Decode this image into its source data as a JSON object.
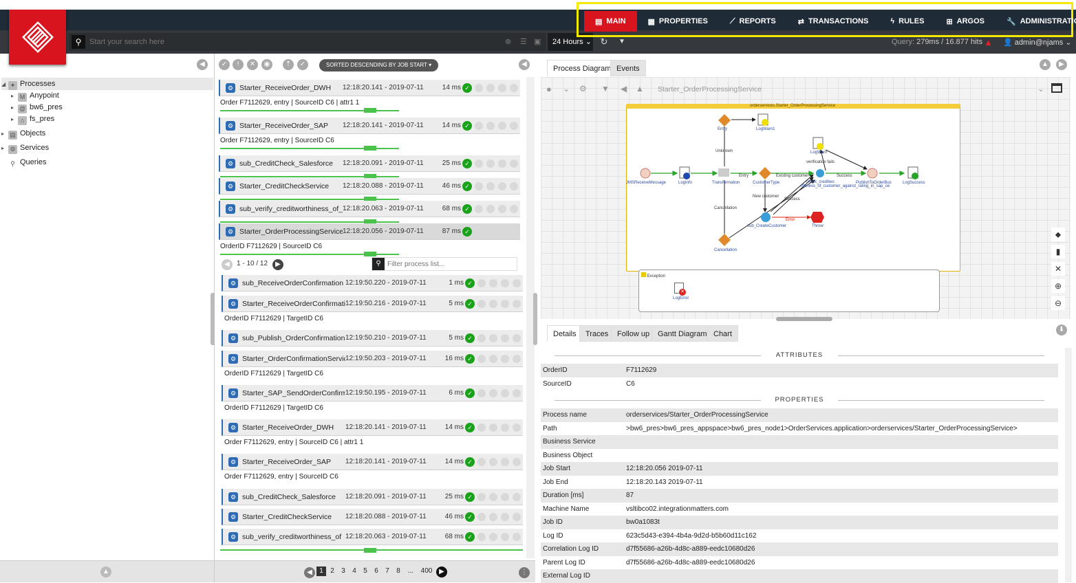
{
  "nav": {
    "items": [
      {
        "label": "MAIN",
        "icon": "main-icon",
        "active": true
      },
      {
        "label": "PROPERTIES",
        "icon": "properties-icon",
        "active": false
      },
      {
        "label": "REPORTS",
        "icon": "reports-icon",
        "active": false
      },
      {
        "label": "TRANSACTIONS",
        "icon": "transactions-icon",
        "active": false
      },
      {
        "label": "RULES",
        "icon": "rules-icon",
        "active": false
      },
      {
        "label": "ARGOS",
        "icon": "argos-icon",
        "active": false
      },
      {
        "label": "ADMINISTRATION",
        "icon": "administration-icon",
        "active": false
      }
    ]
  },
  "search": {
    "placeholder": "Start your search here"
  },
  "timerange": {
    "label": "24 Hours"
  },
  "query": {
    "prefix": "Query:",
    "value": "279ms / 16.877 hits"
  },
  "user": {
    "name": "admin@njams"
  },
  "tree": {
    "processes": "Processes",
    "anypoint": "Anypoint",
    "bw6": "bw6_pres",
    "fs": "fs_pres",
    "objects": "Objects",
    "services": "Services",
    "queries": "Queries"
  },
  "sort": {
    "label": "SORTED DESCENDING BY JOB START"
  },
  "rows": [
    {
      "name": "Starter_ReceiveOrder_DWH",
      "time": "12:18:20.141 - 2019-07-11",
      "dur": "14 ms",
      "attrs": "Order F7112629, entry | SourceID C6 | attr1 1"
    },
    {
      "name": "Starter_ReceiveOrder_SAP",
      "time": "12:18:20.141 - 2019-07-11",
      "dur": "14 ms",
      "attrs": "Order F7112629, entry | SourceID C6"
    },
    {
      "name": "sub_CreditCheck_Salesforce",
      "time": "12:18:20.091 - 2019-07-11",
      "dur": "25 ms"
    },
    {
      "name": "Starter_CreditCheckService",
      "time": "12:18:20.088 - 2019-07-11",
      "dur": "46 ms"
    },
    {
      "name": "sub_verify_creditworthiness_of_",
      "time": "12:18:20.063 - 2019-07-11",
      "dur": "68 ms"
    },
    {
      "name": "Starter_OrderProcessingService",
      "time": "12:18:20.056 - 2019-07-11",
      "dur": "87 ms",
      "attrs": "OrderID F7112629 | SourceID C6"
    }
  ],
  "subpager": {
    "range": "1 - 10 / 12",
    "filter_placeholder": "Filter process list..."
  },
  "subrows": [
    {
      "name": "sub_ReceiveOrderConfirmation",
      "time": "12:19:50.220 - 2019-07-11",
      "dur": "1 ms"
    },
    {
      "name": "Starter_ReceiveOrderConfirmation",
      "time": "12:19:50.216 - 2019-07-11",
      "dur": "5 ms",
      "attrs": "OrderID F7112629 | TargetID C6"
    },
    {
      "name": "sub_Publish_OrderConfirmation",
      "time": "12:19:50.210 - 2019-07-11",
      "dur": "5 ms"
    },
    {
      "name": "Starter_OrderConfirmationService",
      "time": "12:19:50.203 - 2019-07-11",
      "dur": "16 ms",
      "attrs": "OrderID F7112629 | TargetID C6"
    },
    {
      "name": "Starter_SAP_SendOrderConfirm",
      "time": "12:19:50.195 - 2019-07-11",
      "dur": "6 ms",
      "attrs": "OrderID F7112629 | TargetID C6"
    },
    {
      "name": "Starter_ReceiveOrder_DWH",
      "time": "12:18:20.141 - 2019-07-11",
      "dur": "14 ms",
      "attrs": "Order F7112629, entry | SourceID C6 | attr1 1"
    },
    {
      "name": "Starter_ReceiveOrder_SAP",
      "time": "12:18:20.141 - 2019-07-11",
      "dur": "14 ms",
      "attrs": "Order F7112629, entry | SourceID C6"
    },
    {
      "name": "sub_CreditCheck_Salesforce",
      "time": "12:18:20.091 - 2019-07-11",
      "dur": "25 ms"
    },
    {
      "name": "Starter_CreditCheckService",
      "time": "12:18:20.088 - 2019-07-11",
      "dur": "46 ms"
    },
    {
      "name": "sub_verify_creditworthiness_of",
      "time": "12:18:20.063 - 2019-07-11x",
      "dur": "68 ms"
    }
  ],
  "pager": {
    "pages": [
      "1",
      "2",
      "3",
      "4",
      "5",
      "6",
      "7",
      "8",
      "...",
      "400"
    ]
  },
  "diagram": {
    "tabs": [
      "Process Diagram",
      "Events"
    ],
    "process": "Starter_OrderProcessingService",
    "title": "orderservices.Starter_OrderProcessingService",
    "nodes": {
      "entry": "Entry",
      "logwarn1": "LogWarn1",
      "logwarn": "LogWarn",
      "jms": "JMSReceiveMessage",
      "loginfo": "LogInfo",
      "transformation": "Transformation",
      "customertype": "CustomerType",
      "check": "check_creditwo rthiness_of_customer_against_rating_in_sap_ce",
      "publish": "PublishToOrderBus",
      "logsuccess": "LogSuccess",
      "subcreate": "sub_CreateCustomer",
      "throw": "Throw",
      "cancellation": "Cancellation",
      "exception": "Exception",
      "logerror": "LogError"
    },
    "labels": {
      "unknown": "Unknown",
      "entry2": "Entry",
      "existing": "Existing customer",
      "verif": "verification fails",
      "success1": "Success",
      "newcust": "New customer",
      "success2": "Success",
      "error": "Error",
      "cancel": "Cancellation"
    }
  },
  "details": {
    "tabs": [
      "Details",
      "Traces",
      "Follow up",
      "Gantt Diagram",
      "Chart"
    ],
    "attributes_header": "ATTRIBUTES",
    "properties_header": "PROPERTIES",
    "attributes": [
      {
        "k": "OrderID",
        "v": "F7112629"
      },
      {
        "k": "SourceID",
        "v": "C6"
      }
    ],
    "properties": [
      {
        "k": "Process name",
        "v": "orderservices/Starter_OrderProcessingService"
      },
      {
        "k": "Path",
        "v": ">bw6_pres>bw6_pres_appspace>bw6_pres_node1>OrderServices.application>orderservices/Starter_OrderProcessingService>"
      },
      {
        "k": "Business Service",
        "v": ""
      },
      {
        "k": "Business Object",
        "v": ""
      },
      {
        "k": "Job Start",
        "v": "12:18:20.056   2019-07-11"
      },
      {
        "k": "Job End",
        "v": "12:18:20.143   2019-07-11"
      },
      {
        "k": "Duration [ms]",
        "v": "87"
      },
      {
        "k": "Machine Name",
        "v": "vsltibco02.integrationmatters.com"
      },
      {
        "k": "Job ID",
        "v": "bw0a1083t"
      },
      {
        "k": "Log ID",
        "v": "623c5d43-e394-4b4a-9d2d-b5b60d11c162"
      },
      {
        "k": "Correlation Log ID",
        "v": "d7f55686-a26b-4d8c-a889-eedc10680d26"
      },
      {
        "k": "Parent Log ID",
        "v": "d7f55686-a26b-4d8c-a889-eedc10680d26"
      },
      {
        "k": "External Log ID",
        "v": ""
      }
    ]
  },
  "colors": {
    "brand": "#d8141e",
    "highlight": "#f5e900",
    "topbar": "#1f2b37",
    "success": "#1aa21a"
  }
}
